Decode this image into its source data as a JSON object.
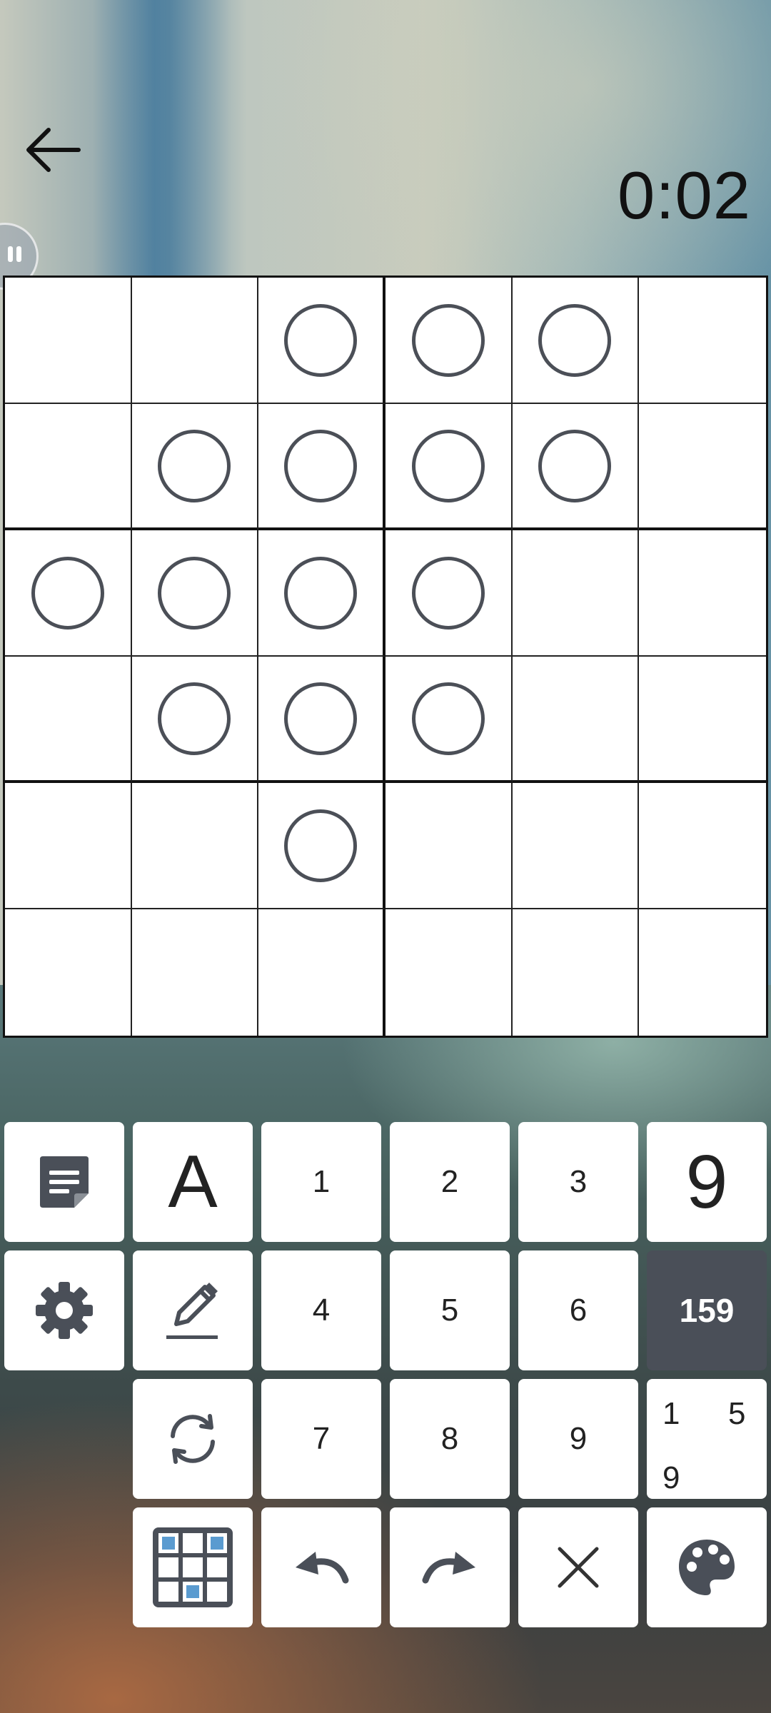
{
  "header": {
    "back_icon": "arrow-left-icon",
    "timer": "0:02",
    "pause_icon": "pause-icon"
  },
  "grid": {
    "size": 6,
    "rows": [
      [
        false,
        false,
        true,
        true,
        true,
        false
      ],
      [
        false,
        true,
        true,
        true,
        true,
        false
      ],
      [
        true,
        true,
        true,
        true,
        false,
        false
      ],
      [
        false,
        true,
        true,
        true,
        false,
        false
      ],
      [
        false,
        false,
        true,
        false,
        false,
        false
      ],
      [
        false,
        false,
        false,
        false,
        false,
        false
      ]
    ]
  },
  "keypad": {
    "notes_icon": "note-icon",
    "text_mode_label": "A",
    "digits": [
      "1",
      "2",
      "3",
      "4",
      "5",
      "6",
      "7",
      "8",
      "9"
    ],
    "big_digit_label": "9",
    "digit_set_label": "159",
    "settings_icon": "gear-icon",
    "pencil_icon": "pencil-icon",
    "refresh_icon": "refresh-icon",
    "corner_digits": [
      "1",
      "5",
      "9"
    ],
    "grid_icon": "grid-select-icon",
    "undo_icon": "undo-icon",
    "redo_icon": "redo-icon",
    "clear_icon": "close-icon",
    "palette_icon": "palette-icon"
  },
  "colors": {
    "circle_stroke": "#4b4f57",
    "selected_key": "#4a4f58",
    "grid_icon_accent": "#5a9bd0"
  }
}
